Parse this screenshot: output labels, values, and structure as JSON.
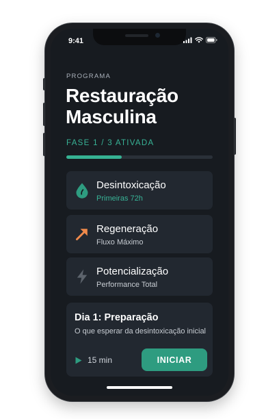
{
  "status_bar": {
    "time": "9:41",
    "icons": [
      "signal-icon",
      "wifi-icon",
      "battery-icon"
    ]
  },
  "header": {
    "eyebrow": "PROGRAMA",
    "title_line1": "Restauração",
    "title_line2": "Masculina",
    "phase": "FASE 1 / 3 ATIVADA",
    "progress_fraction": 0.38
  },
  "stages": [
    {
      "name": "Desintoxicação",
      "subtitle": "Primeiras 72h",
      "icon": "drop-icon",
      "icon_color": "#2e9c80",
      "subtitle_color": "#38b497"
    },
    {
      "name": "Regeneração",
      "subtitle": "Fluxo Máximo",
      "icon": "arrow-up-right-icon",
      "icon_color": "#f08a4b"
    },
    {
      "name": "Potencialização",
      "subtitle": "Performance Total",
      "icon": "lightning-icon",
      "icon_color": "#5d646d"
    }
  ],
  "day_card": {
    "title": "Dia 1: Preparação",
    "description": "O que esperar da desintoxicação inicial",
    "duration": "15 min",
    "button_label": "INICIAR"
  },
  "colors": {
    "accent": "#38b497",
    "button": "#2e9c80",
    "background": "#171b20",
    "card": "#222830",
    "orange": "#f08a4b"
  }
}
